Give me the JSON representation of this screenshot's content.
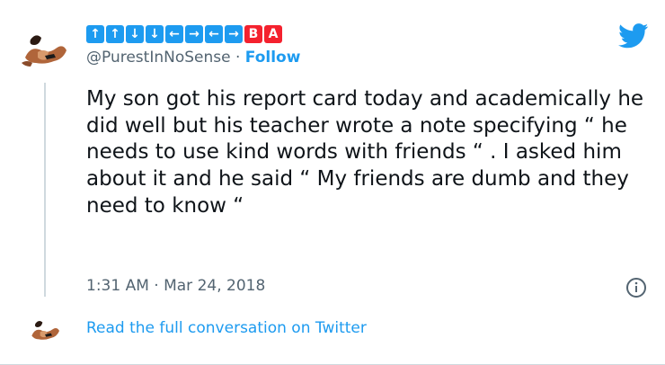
{
  "tweet": {
    "display_name_keys": [
      "↑",
      "↑",
      "↓",
      "↓",
      "←",
      "→",
      "←",
      "→",
      "B",
      "A"
    ],
    "handle": "@PurestInNoSense",
    "separator": "·",
    "follow_label": "Follow",
    "text": "My son got his report card today and academically he did well but his teacher wrote a note specifying “ he needs to use kind words with friends “ . I asked him about it and he said “ My friends are dumb and they need to know “",
    "timestamp": "1:31 AM · Mar 24, 2018"
  },
  "footer": {
    "read_full_label": "Read the full conversation on Twitter"
  },
  "icons": {
    "brand": "twitter-bird-icon",
    "info": "info-icon"
  },
  "colors": {
    "accent": "#1d9bf0",
    "key_red": "#f4212e",
    "secondary_text": "#536471",
    "thread_line": "#cfd9de"
  }
}
